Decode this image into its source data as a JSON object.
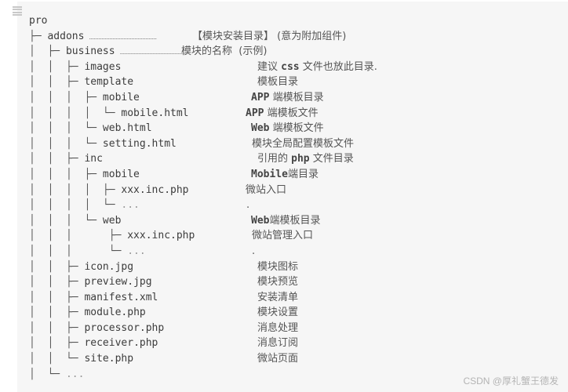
{
  "toolbar": {
    "icon": "list-icon"
  },
  "tree": [
    {
      "prefix": "",
      "name": "pro",
      "dots": "",
      "comment": ""
    },
    {
      "prefix": "├─ ",
      "name": "addons",
      "dots": "...........................................",
      "comment": "【模块安装目录】 (意为附加组件)"
    },
    {
      "prefix": "│  ├─ ",
      "name": "business",
      "dots": "..........................................",
      "comment": "模块的名称  (示例)"
    },
    {
      "prefix": "│  │  ├─ ",
      "name": "images",
      "dots": "",
      "comment_pre": "建议 ",
      "comment_mono": "css",
      "comment_post": " 文件也放此目录."
    },
    {
      "prefix": "│  │  ├─ ",
      "name": "template",
      "dots": "",
      "comment": "模板目录"
    },
    {
      "prefix": "│  │  │  ├─ ",
      "name": "mobile",
      "dots": "",
      "comment_mono": "APP",
      "comment_post": " 端模板目录"
    },
    {
      "prefix": "│  │  │  │  └─ ",
      "name": "mobile.html",
      "dots": "",
      "comment_mono": "APP",
      "comment_post": " 端模板文件"
    },
    {
      "prefix": "│  │  │  └─ ",
      "name": "web.html",
      "dots": "",
      "comment_mono": "Web",
      "comment_post": " 端模板文件"
    },
    {
      "prefix": "│  │  │  └─ ",
      "name": "setting.html",
      "dots": "",
      "comment": "模块全局配置模板文件"
    },
    {
      "prefix": "│  │  ├─ ",
      "name": "inc",
      "dots": "",
      "comment_pre": "引用的 ",
      "comment_mono": "php",
      "comment_post": " 文件目录"
    },
    {
      "prefix": "│  │  │  ├─ ",
      "name": "mobile",
      "dots": "",
      "comment_mono": "Mobile",
      "comment_post": "端目录"
    },
    {
      "prefix": "│  │  │  │  ├─ ",
      "name": "xxx.inc.php",
      "dots": "",
      "comment": "微站入口"
    },
    {
      "prefix": "│  │  │  │  └─ ",
      "name": "...",
      "dots": "",
      "comment": "."
    },
    {
      "prefix": "│  │  │  └─ ",
      "name": "web",
      "dots": "",
      "comment_mono": "Web",
      "comment_post": "端模板目录"
    },
    {
      "prefix": "│  │  │      ├─ ",
      "name": "xxx.inc.php",
      "dots": "",
      "comment": "微站管理入口"
    },
    {
      "prefix": "│  │  │      └─ ",
      "name": "...",
      "dots": "",
      "comment": "."
    },
    {
      "prefix": "│  │  ├─ ",
      "name": "icon.jpg",
      "dots": "",
      "comment": "模块图标"
    },
    {
      "prefix": "│  │  ├─ ",
      "name": "preview.jpg",
      "dots": "",
      "comment": "模块预览"
    },
    {
      "prefix": "│  │  ├─ ",
      "name": "manifest.xml",
      "dots": "",
      "comment": "安装清单"
    },
    {
      "prefix": "│  │  ├─ ",
      "name": "module.php",
      "dots": "",
      "comment": "模块设置"
    },
    {
      "prefix": "│  │  ├─ ",
      "name": "processor.php",
      "dots": "",
      "comment": "消息处理"
    },
    {
      "prefix": "│  │  ├─ ",
      "name": "receiver.php",
      "dots": "",
      "comment": "消息订阅"
    },
    {
      "prefix": "│  │  └─ ",
      "name": "site.php",
      "dots": "",
      "comment": "微站页面"
    },
    {
      "prefix": "│  └─ ",
      "name": "...",
      "dots": "",
      "comment": ""
    }
  ],
  "watermark": "CSDN @厚礼蟹王德发"
}
